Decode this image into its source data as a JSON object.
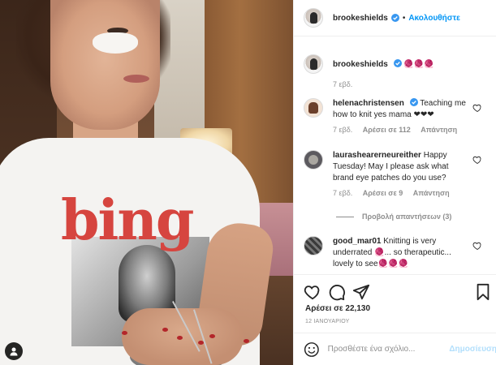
{
  "post": {
    "image_alt_word": "bing"
  },
  "header": {
    "username": "brookeshields",
    "separator": "•",
    "follow_label": "Ακολουθήστε"
  },
  "caption": {
    "username": "brookeshields",
    "text": "🧶🧶🧶",
    "time": "7 εβδ."
  },
  "comments": [
    {
      "username": "helenachristensen",
      "verified": true,
      "text": "Teaching me how to knit yes mama ❤❤❤",
      "time": "7 εβδ.",
      "likes": "Αρέσει σε 112",
      "reply_label": "Απάντηση"
    },
    {
      "username": "laurashearerneureither",
      "verified": false,
      "text": "Happy Tuesday! May I please ask what brand eye patches do you use?",
      "time": "7 εβδ.",
      "likes": "Αρέσει σε 9",
      "reply_label": "Απάντηση",
      "view_replies": "Προβολή απαντήσεων (3)"
    },
    {
      "username": "good_mar01",
      "verified": false,
      "text": "Knitting is very underrated 🧶... so therapeutic... lovely to see🧶🧶🧶",
      "time": "",
      "likes": "",
      "reply_label": ""
    }
  ],
  "actions": {
    "like_icon": "heart-icon",
    "comment_icon": "comment-icon",
    "share_icon": "share-icon",
    "save_icon": "bookmark-icon"
  },
  "likes_text": "Αρέσει σε 22,130",
  "date_text": "12 ΙΑΝΟΥΑΡΙΟΥ",
  "add_comment": {
    "placeholder": "Προσθέστε ένα σχόλιο...",
    "post_label": "Δημοσίευση"
  },
  "colors": {
    "link_blue": "#0095f6",
    "post_disabled": "#b2dffc",
    "muted": "#8e8e8e",
    "border": "#efefef"
  }
}
